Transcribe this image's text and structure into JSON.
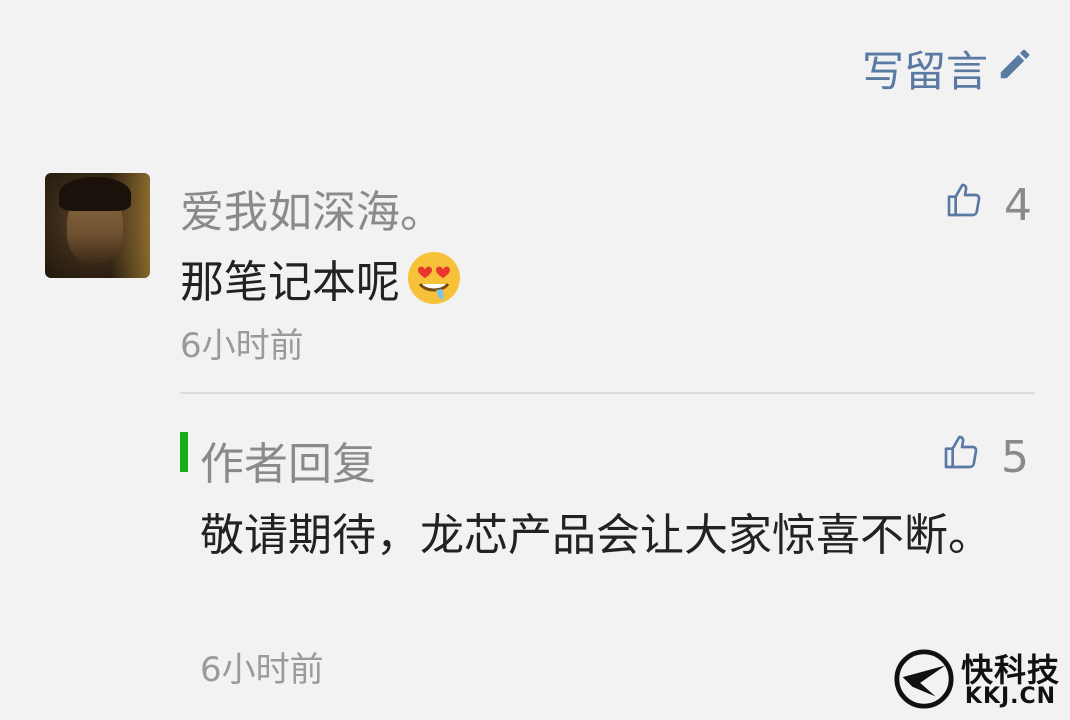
{
  "header": {
    "write_comment_label": "写留言"
  },
  "comment": {
    "nickname": "爱我如深海。",
    "text": "那笔记本呢",
    "time": "6小时前",
    "likes": "4"
  },
  "reply": {
    "title": "作者回复",
    "text": "敬请期待，龙芯产品会让大家惊喜不断。",
    "time": "6小时前",
    "likes": "5"
  },
  "watermark": {
    "name": "快科技",
    "domain": "KKJ.CN"
  },
  "colors": {
    "link": "#5b7aa3",
    "reply_accent": "#1aad19",
    "muted": "#8a8a8a"
  },
  "icons": {
    "edit": "pencil-icon",
    "like": "thumbs-up-icon",
    "emoji": "heart-eyes-drooling-emoji"
  }
}
